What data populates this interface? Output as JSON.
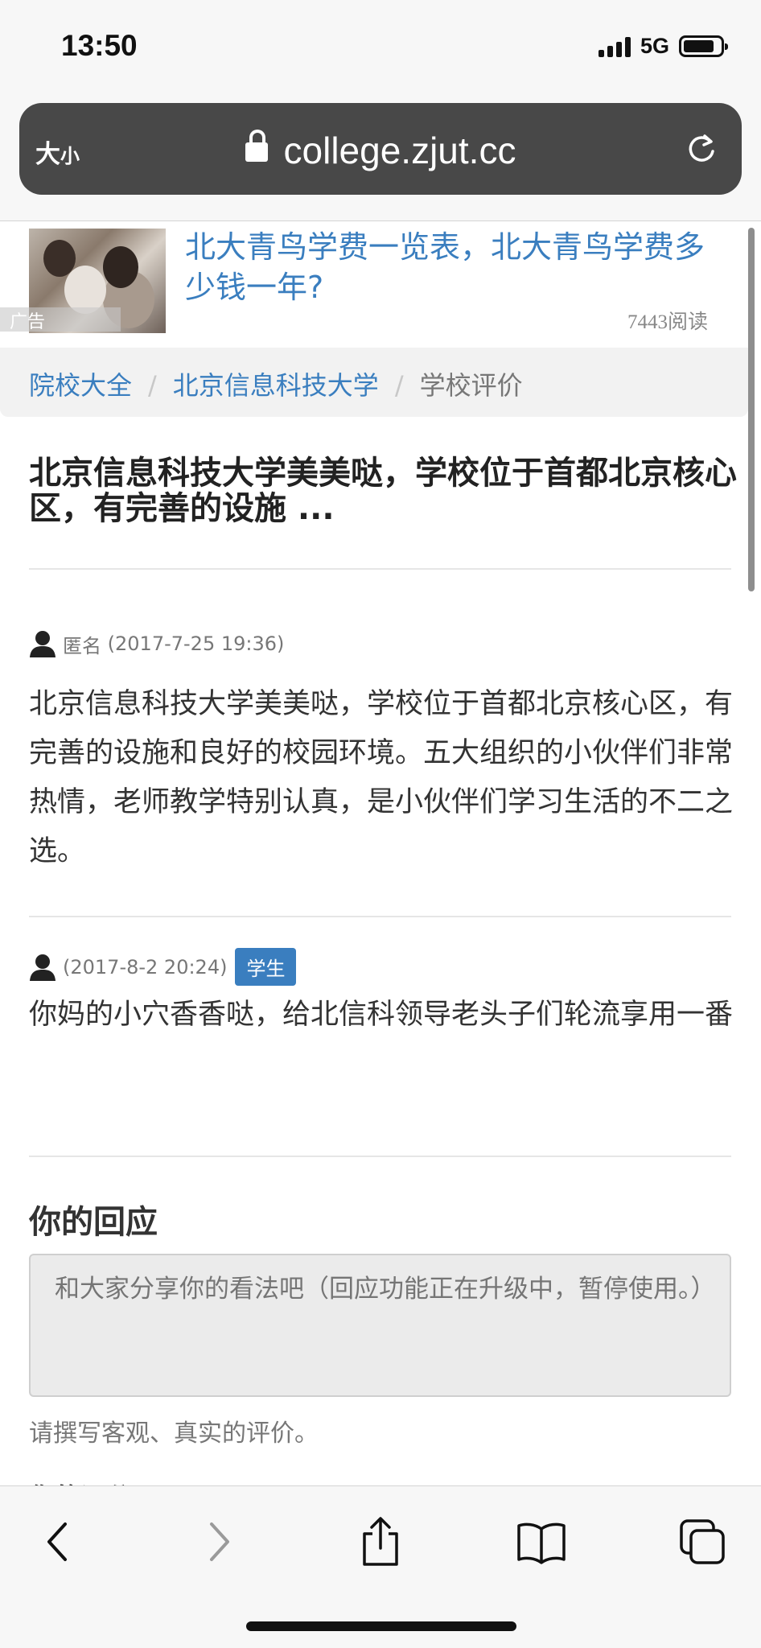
{
  "status_bar": {
    "time": "13:50",
    "network": "5G",
    "battery_level": 0.85
  },
  "browser": {
    "text_size_label": "大",
    "text_size_label_small": "小",
    "url": "college.zjut.cc"
  },
  "ad": {
    "title": "北大青鸟学费一览表，北大青鸟学费多少钱一年?",
    "reads": "7443阅读",
    "badge": "广告"
  },
  "breadcrumb": {
    "items": [
      "院校大全",
      "北京信息科技大学",
      "学校评价"
    ],
    "separator": "/"
  },
  "post": {
    "title": "北京信息科技大学美美哒，学校位于首都北京核心区，有完善的设施 ..."
  },
  "comments": [
    {
      "author": "匿名",
      "time": "(2017-7-25 19:36)",
      "text": "北京信息科技大学美美哒，学校位于首都北京核心区，有完善的设施和良好的校园环境。五大组织的小伙伴们非常热情，老师教学特别认真，是小伙伴们学习生活的不二之选。"
    },
    {
      "author": "",
      "time": "(2017-8-2 20:24)",
      "tag": "学生",
      "text": "你妈的小穴香香哒，给北信科领导老头子们轮流享用一番"
    }
  ],
  "reply": {
    "heading": "你的回应",
    "placeholder": "和大家分享你的看法吧（回应功能正在升级中，暂停使用。）",
    "help": "请撰写客观、真实的评价。",
    "next_heading": "你的评分"
  },
  "toolbar": {
    "icons": [
      "back-icon",
      "forward-icon",
      "share-icon",
      "bookmarks-icon",
      "tabs-icon"
    ]
  }
}
